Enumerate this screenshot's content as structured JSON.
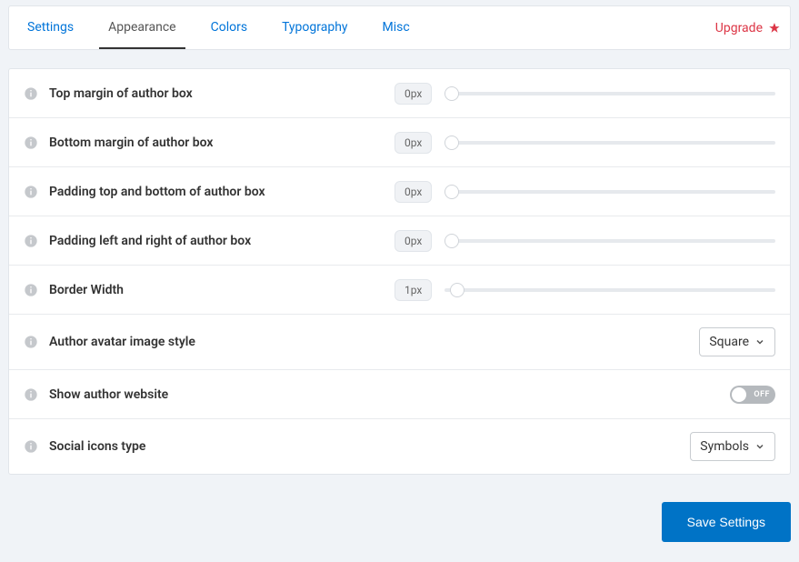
{
  "tabs": {
    "items": [
      {
        "label": "Settings",
        "active": false
      },
      {
        "label": "Appearance",
        "active": true
      },
      {
        "label": "Colors",
        "active": false
      },
      {
        "label": "Typography",
        "active": false
      },
      {
        "label": "Misc",
        "active": false
      }
    ],
    "upgrade_label": "Upgrade"
  },
  "settings": {
    "top_margin": {
      "label": "Top margin of author box",
      "value": "0px"
    },
    "bottom_margin": {
      "label": "Bottom margin of author box",
      "value": "0px"
    },
    "padding_tb": {
      "label": "Padding top and bottom of author box",
      "value": "0px"
    },
    "padding_lr": {
      "label": "Padding left and right of author box",
      "value": "0px"
    },
    "border_width": {
      "label": "Border Width",
      "value": "1px"
    },
    "avatar_style": {
      "label": "Author avatar image style",
      "value": "Square"
    },
    "show_website": {
      "label": "Show author website",
      "toggle": "OFF"
    },
    "social_icons": {
      "label": "Social icons type",
      "value": "Symbols"
    }
  },
  "footer": {
    "save_label": "Save Settings"
  }
}
